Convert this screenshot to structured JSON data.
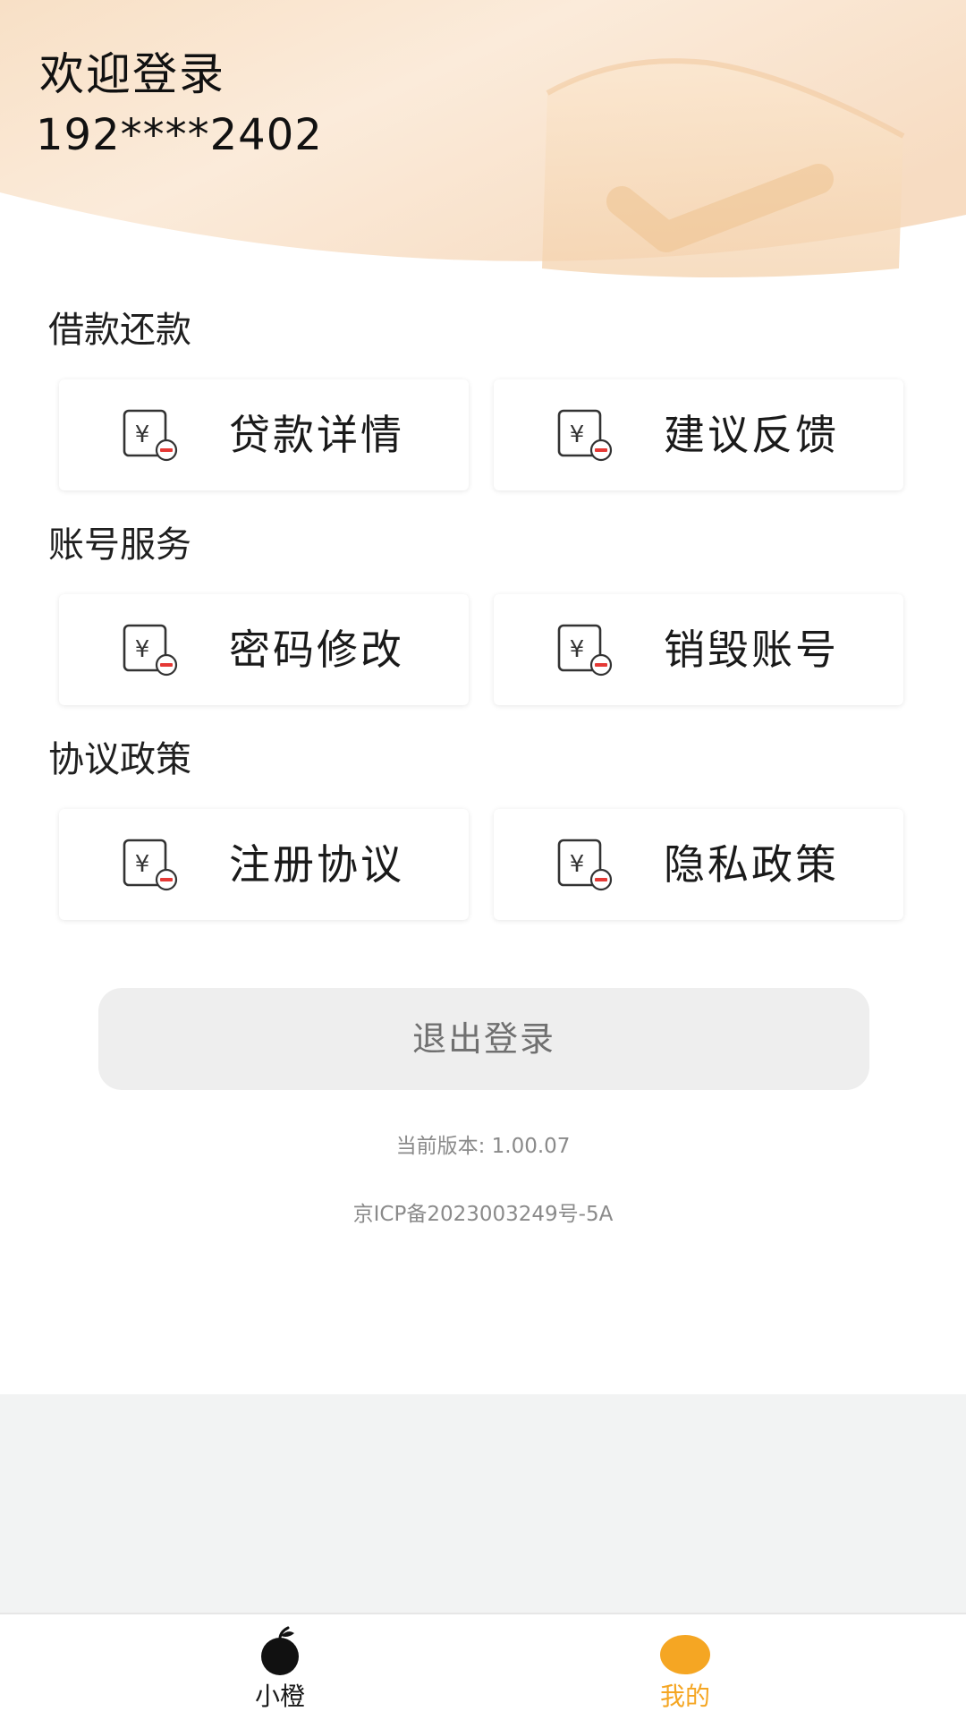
{
  "header": {
    "title": "欢迎登录",
    "phone": "192****2402"
  },
  "sections": [
    {
      "title": "借款还款",
      "items": [
        {
          "label": "贷款详情",
          "icon": "yuan-bill-icon"
        },
        {
          "label": "建议反馈",
          "icon": "yuan-bill-icon"
        }
      ]
    },
    {
      "title": "账号服务",
      "items": [
        {
          "label": "密码修改",
          "icon": "yuan-bill-icon"
        },
        {
          "label": "销毁账号",
          "icon": "yuan-bill-icon"
        }
      ]
    },
    {
      "title": "协议政策",
      "items": [
        {
          "label": "注册协议",
          "icon": "yuan-bill-icon"
        },
        {
          "label": "隐私政策",
          "icon": "yuan-bill-icon"
        }
      ]
    }
  ],
  "logout": {
    "label": "退出登录"
  },
  "footer": {
    "version": "当前版本: 1.00.07",
    "icp": "京ICP备2023003249号-5A"
  },
  "tabbar": {
    "home": {
      "label": "小橙",
      "icon": "orange-fruit-icon"
    },
    "mine": {
      "label": "我的",
      "icon": "profile-dot-icon"
    }
  },
  "colors": {
    "accent": "#f5a623",
    "header_gradient_start": "#f7dcc0",
    "header_gradient_end": "#fbeedd",
    "logout_bg": "#eeeeee",
    "icon_minus": "#e53935"
  }
}
